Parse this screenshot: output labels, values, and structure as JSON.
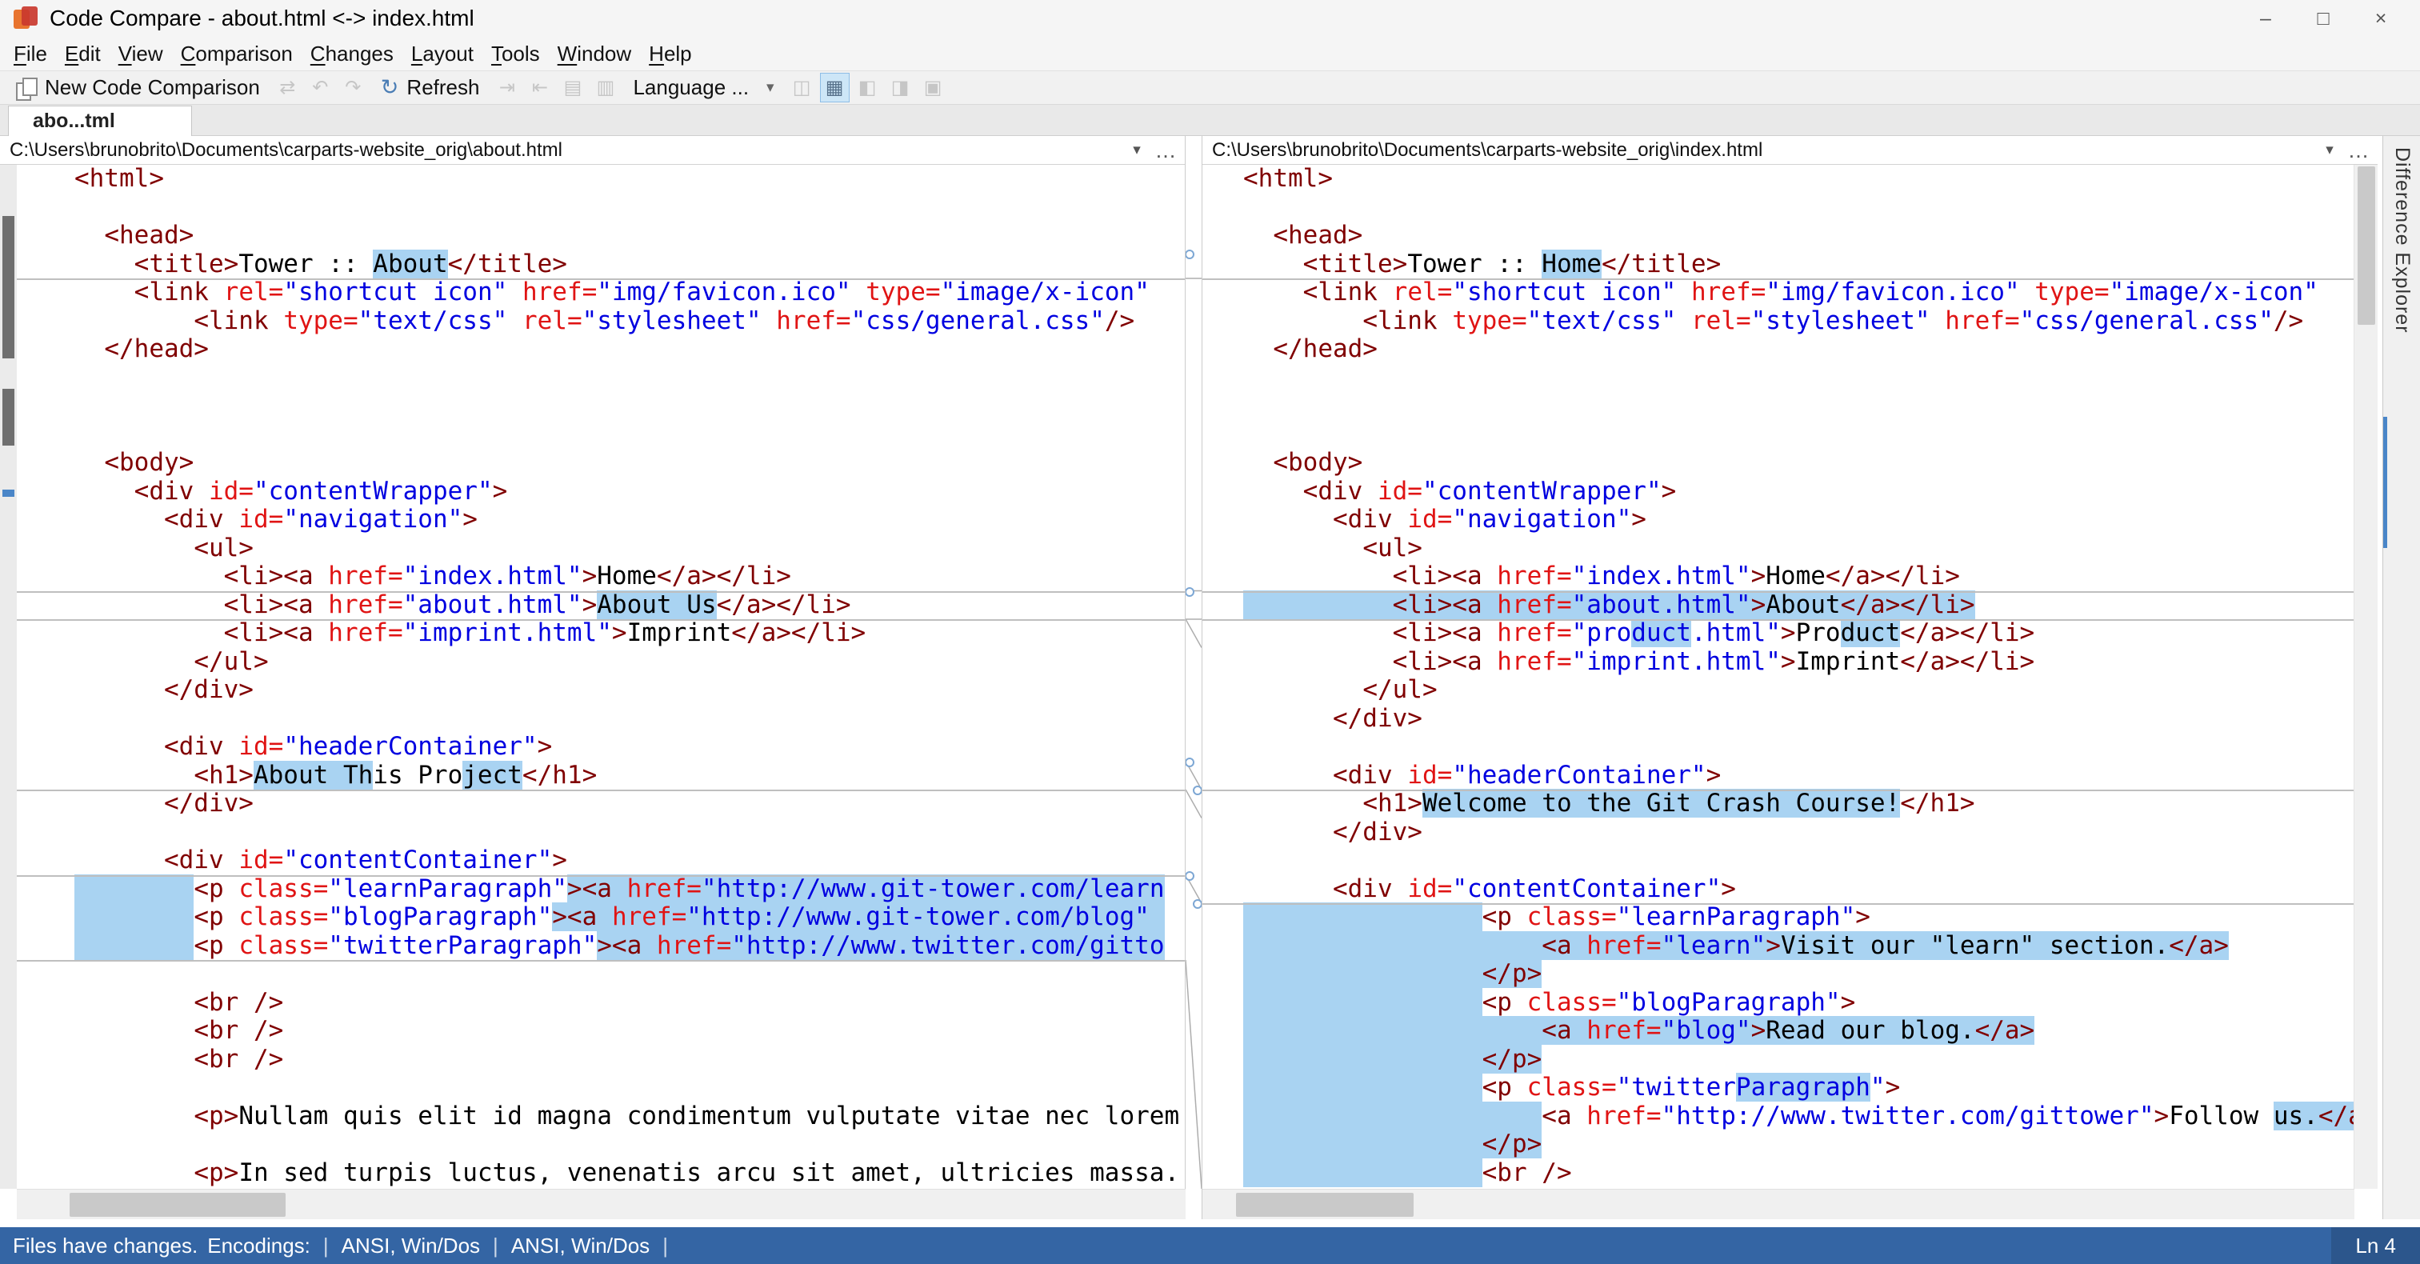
{
  "colors": {
    "tag": "#800000",
    "attribute": "#e01414",
    "value": "#0000e0",
    "text": "#000000",
    "diff_highlight": "#a9d3f2",
    "statusbar": "#3465a4",
    "accent": "#4a86c8"
  },
  "titlebar": {
    "title": "Code Compare - about.html <-> index.html",
    "controls": {
      "minimize": "–",
      "maximize": "□",
      "close": "×"
    }
  },
  "menubar": {
    "items": [
      "File",
      "Edit",
      "View",
      "Comparison",
      "Changes",
      "Layout",
      "Tools",
      "Window",
      "Help"
    ]
  },
  "toolbar": {
    "items": [
      {
        "type": "label",
        "name": "new-code-comparison",
        "label": "New Code Comparison",
        "icon": "new-comparison-icon",
        "enabled": true
      },
      {
        "type": "icons",
        "name": "navigate-group",
        "glyphs": [
          "⇄",
          "↶",
          "↷"
        ],
        "enabled": false
      },
      {
        "type": "label",
        "name": "refresh",
        "label": "Refresh",
        "icon": "refresh-icon",
        "enabled": true
      },
      {
        "type": "icons",
        "name": "merge-group",
        "glyphs": [
          "⇥",
          "⇤",
          "▤",
          "▥"
        ],
        "enabled": false
      },
      {
        "type": "dropdown",
        "name": "language",
        "label": "Language ...",
        "enabled": true
      },
      {
        "type": "icons",
        "name": "view-group-a",
        "glyphs": [
          "◫"
        ],
        "enabled": false
      },
      {
        "type": "icons",
        "name": "view-group-b",
        "glyphs": [
          "▦"
        ],
        "enabled": true,
        "active": true
      },
      {
        "type": "icons",
        "name": "view-group-c",
        "glyphs": [
          "◧",
          "◨",
          "▣"
        ],
        "enabled": false
      }
    ]
  },
  "tab": {
    "label": "abo...tml"
  },
  "panes": [
    {
      "path": "C:\\Users\\brunobrito\\Documents\\carparts-website_orig\\about.html",
      "lines": [
        {
          "t": "<html>"
        },
        {
          "t": ""
        },
        {
          "t": "  <head>"
        },
        {
          "t": "    <title>Tower :: About</title>",
          "hl": [
            "About"
          ]
        },
        {
          "t": "    <link rel=\"shortcut icon\" href=\"img/favicon.ico\" type=\"image/x-icon\"",
          "sep": true
        },
        {
          "t": "        <link type=\"text/css\" rel=\"stylesheet\" href=\"css/general.css\"/>"
        },
        {
          "t": "  </head>"
        },
        {
          "t": ""
        },
        {
          "t": ""
        },
        {
          "t": ""
        },
        {
          "t": "  <body>"
        },
        {
          "t": "    <div id=\"contentWrapper\">"
        },
        {
          "t": "      <div id=\"navigation\">"
        },
        {
          "t": "        <ul>"
        },
        {
          "t": "          <li><a href=\"index.html\">Home</a></li>"
        },
        {
          "t": "          <li><a href=\"about.html\">About Us</a></li>",
          "hl": [
            "About Us"
          ],
          "sep": true
        },
        {
          "t": "          <li><a href=\"imprint.html\">Imprint</a></li>",
          "sep": true
        },
        {
          "t": "        </ul>"
        },
        {
          "t": "      </div>"
        },
        {
          "t": ""
        },
        {
          "t": "      <div id=\"headerContainer\">"
        },
        {
          "t": "        <h1>About This Project</h1>",
          "hl": [
            "About Th",
            "ject"
          ]
        },
        {
          "t": "      </div>",
          "sep": true
        },
        {
          "t": ""
        },
        {
          "t": "      <div id=\"contentContainer\">"
        },
        {
          "t": "        <p class=\"learnParagraph\"><a href=\"http://www.git-tower.com/learn",
          "lead": true,
          "hl": [
            "><a href=\"http://www.git-tower.com/learn"
          ],
          "sep": true
        },
        {
          "t": "        <p class=\"blogParagraph\"><a href=\"http://www.git-tower.com/blog\" ",
          "lead": true,
          "hl": [
            "><a href=\"http://www.git-tower.com/blog\" "
          ]
        },
        {
          "t": "        <p class=\"twitterParagraph\"><a href=\"http://www.twitter.com/gitto",
          "lead": true,
          "hl": [
            "><a href=\"http://www.twitter.com/gitto"
          ]
        },
        {
          "t": "",
          "sep": true
        },
        {
          "t": "        <br />"
        },
        {
          "t": "        <br />"
        },
        {
          "t": "        <br />"
        },
        {
          "t": ""
        },
        {
          "t": "        <p>Nullam quis elit id magna condimentum vulputate vitae nec lorem."
        },
        {
          "t": ""
        },
        {
          "t": "        <p>In sed turpis luctus, venenatis arcu sit amet, ultricies massa."
        }
      ]
    },
    {
      "path": "C:\\Users\\brunobrito\\Documents\\carparts-website_orig\\index.html",
      "lines": [
        {
          "t": "<html>"
        },
        {
          "t": ""
        },
        {
          "t": "  <head>"
        },
        {
          "t": "    <title>Tower :: Home</title>",
          "hl": [
            "Home"
          ]
        },
        {
          "t": "    <link rel=\"shortcut icon\" href=\"img/favicon.ico\" type=\"image/x-icon\"",
          "sep": true
        },
        {
          "t": "        <link type=\"text/css\" rel=\"stylesheet\" href=\"css/general.css\"/>"
        },
        {
          "t": "  </head>"
        },
        {
          "t": ""
        },
        {
          "t": ""
        },
        {
          "t": ""
        },
        {
          "t": "  <body>"
        },
        {
          "t": "    <div id=\"contentWrapper\">"
        },
        {
          "t": "      <div id=\"navigation\">"
        },
        {
          "t": "        <ul>"
        },
        {
          "t": "          <li><a href=\"index.html\">Home</a></li>"
        },
        {
          "t": "          <li><a href=\"about.html\">About</a></li>",
          "full": true,
          "sep": true
        },
        {
          "t": "          <li><a href=\"product.html\">Product</a></li>",
          "hl": [
            "duct",
            "duct"
          ],
          "sep": true
        },
        {
          "t": "          <li><a href=\"imprint.html\">Imprint</a></li>"
        },
        {
          "t": "        </ul>"
        },
        {
          "t": "      </div>"
        },
        {
          "t": ""
        },
        {
          "t": "      <div id=\"headerContainer\">"
        },
        {
          "t": "        <h1>Welcome to the Git Crash Course!</h1>",
          "hl": [
            "Welcome to the Git Crash Course!"
          ],
          "sep": true
        },
        {
          "t": "      </div>"
        },
        {
          "t": ""
        },
        {
          "t": "      <div id=\"contentContainer\">"
        },
        {
          "t": "                <p class=\"learnParagraph\">",
          "lead": true,
          "sep": true
        },
        {
          "t": "                    <a href=\"learn\">Visit our \"learn\" section.</a>",
          "full": true
        },
        {
          "t": "                </p>",
          "full": true
        },
        {
          "t": "                <p class=\"blogParagraph\">",
          "lead": true
        },
        {
          "t": "                    <a href=\"blog\">Read our blog.</a>",
          "full": true
        },
        {
          "t": "                </p>",
          "full": true
        },
        {
          "t": "                <p class=\"twitterParagraph\">",
          "lead": true,
          "hl": [
            "Paragraph"
          ]
        },
        {
          "t": "                    <a href=\"http://www.twitter.com/gittower\">Follow us.</a>",
          "lead": true,
          "hl": [
            "us.</a>"
          ]
        },
        {
          "t": "                </p>",
          "full": true
        },
        {
          "t": "                <br />",
          "lead": true
        }
      ]
    }
  ],
  "diff_explorer": {
    "label": "Difference Explorer"
  },
  "statusbar": {
    "message": "Files have changes.",
    "encodings_label": "Encodings:",
    "encodings": [
      "ANSI, Win/Dos",
      "ANSI, Win/Dos"
    ],
    "line_indicator": "Ln 4"
  }
}
